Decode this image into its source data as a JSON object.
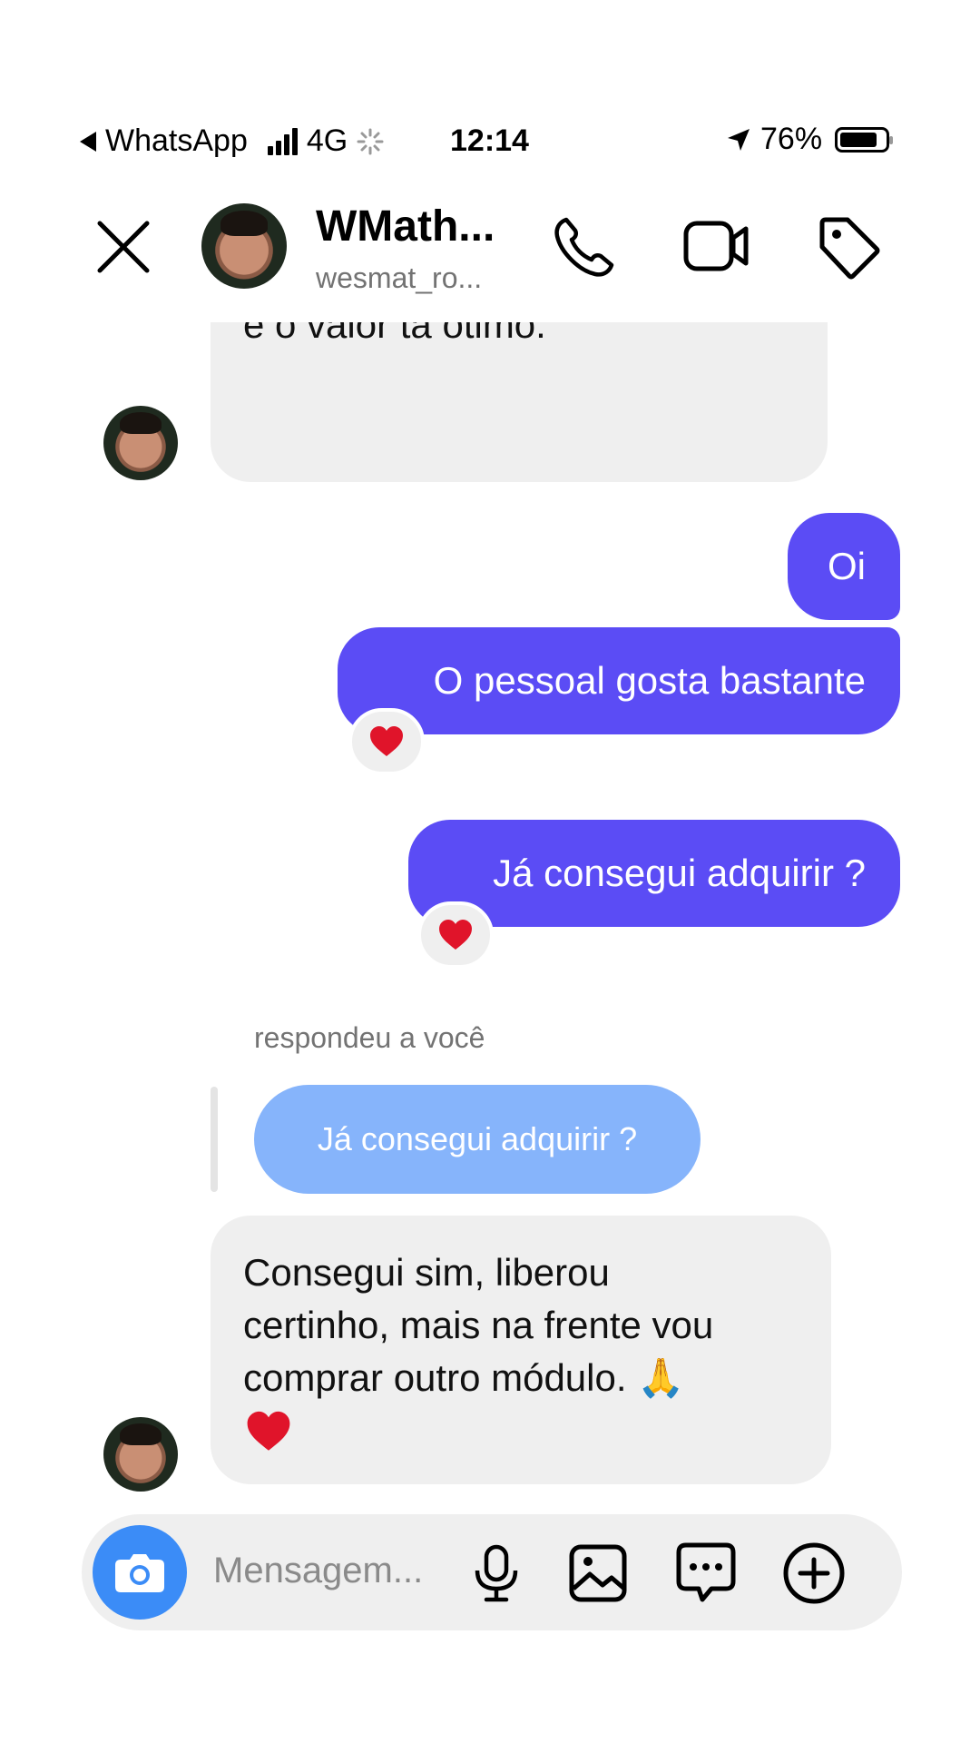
{
  "status_bar": {
    "back_app": "WhatsApp",
    "network": "4G",
    "time": "12:14",
    "battery": "76%"
  },
  "header": {
    "name": "WMath...",
    "username": "wesmat_ro..."
  },
  "messages": {
    "first_incoming": "material, e já estava precisando e o valor tá ótimo.",
    "out_1": "Oi",
    "out_2": "O pessoal gosta bastante",
    "out_3": "Já consegui adquirir ?",
    "reply_label": "respondeu a você",
    "quoted": "Já consegui adquirir ?",
    "last_incoming_line1": "Consegui sim, liberou",
    "last_incoming_line2": "certinho, mais na frente vou",
    "last_incoming_line3": "comprar outro módulo. 🙏"
  },
  "composer": {
    "placeholder": "Mensagem..."
  },
  "colors": {
    "outgoing_bubble": "#5b4cf5",
    "quoted_bubble": "#86b4fb",
    "incoming_bubble": "#efefef",
    "camera_button": "#3b8cf7"
  }
}
